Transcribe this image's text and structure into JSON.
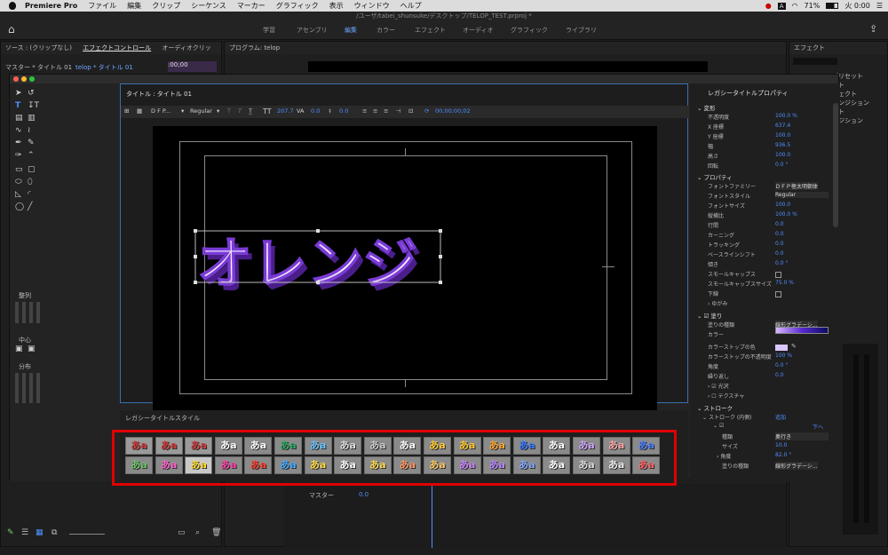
{
  "menubar": {
    "app": "Premiere Pro",
    "items": [
      "ファイル",
      "編集",
      "クリップ",
      "シーケンス",
      "マーカー",
      "グラフィック",
      "表示",
      "ウィンドウ",
      "ヘルプ"
    ],
    "battery": "71%",
    "clock": "火 0:00"
  },
  "path_title": "/ユーザ/tabei_shunsuke/デスクトップ/TELOP_TEST.prproj *",
  "workspaces": {
    "tabs": [
      "学習",
      "アセンブリ",
      "編集",
      "カラー",
      "エフェクト",
      "オーディオ",
      "グラフィック",
      "ライブラリ"
    ],
    "active": "編集"
  },
  "left_panel": {
    "tabs": [
      "ソース : (クリップなし)",
      "エフェクトコントロール",
      "オーディオクリッ"
    ],
    "master": "マスター * タイトル 01",
    "sequence": "telop * タイトル 01",
    "timecode": ":00;00"
  },
  "program": {
    "title": "プログラム: telop"
  },
  "effects": {
    "title": "エフェクト",
    "items": [
      "プリセット",
      "ット",
      "フェクト",
      "ランジション",
      "クト",
      "ンジション"
    ]
  },
  "title_panel": {
    "title": "タイトル : タイトル 01",
    "font": "D F P...",
    "style": "Regular",
    "size": "207.7",
    "kerning": "0.0",
    "leading": "0.0",
    "timecode": "00;00;00;02",
    "text": "オレンジ"
  },
  "tools": {
    "align_label": "整列",
    "center_label": "中心",
    "dist_label": "分布"
  },
  "props": {
    "title": "レガシータイトルプロパティ",
    "sections": {
      "transform": "変形",
      "properties": "プロパティ",
      "fill": "塗り",
      "stroke": "ストローク",
      "inner_stroke": "ストローク (内側)",
      "distort": "ゆがみ"
    },
    "transform": [
      {
        "label": "不透明度",
        "value": "100.0 %"
      },
      {
        "label": "X 座標",
        "value": "637.4"
      },
      {
        "label": "Y 座標",
        "value": "100.0"
      },
      {
        "label": "幅",
        "value": "936.5"
      },
      {
        "label": "高さ",
        "value": "100.0"
      },
      {
        "label": "回転",
        "value": "0.0 °"
      }
    ],
    "properties": [
      {
        "label": "フォントファミリー",
        "value": "ＤＦＰ極太明朝体"
      },
      {
        "label": "フォントスタイル",
        "value": "Regular"
      },
      {
        "label": "フォントサイズ",
        "value": "100.0"
      },
      {
        "label": "縦横比",
        "value": "100.0 %"
      },
      {
        "label": "行間",
        "value": "0.0"
      },
      {
        "label": "カーニング",
        "value": "0.0"
      },
      {
        "label": "トラッキング",
        "value": "0.0"
      },
      {
        "label": "ベースラインシフト",
        "value": "0.0"
      },
      {
        "label": "傾き",
        "value": "0.0 °"
      },
      {
        "label": "スモールキャップス",
        "value": ""
      },
      {
        "label": "スモールキャップスサイズ",
        "value": "75.0 %"
      },
      {
        "label": "下線",
        "value": ""
      }
    ],
    "fill": [
      {
        "label": "塗りの種類",
        "value": "線形グラデーシ..."
      },
      {
        "label": "カラー",
        "value": ""
      },
      {
        "label": "カラーストップの色",
        "value": ""
      },
      {
        "label": "カラーストップの不透明度",
        "value": "100 %"
      },
      {
        "label": "角度",
        "value": "0.0 °"
      },
      {
        "label": "繰り返し",
        "value": "0.0"
      },
      {
        "label": "光沢",
        "value": ""
      },
      {
        "label": "テクスチャ",
        "value": ""
      }
    ],
    "stroke": {
      "add": "追加",
      "down": "下へ",
      "rows": [
        {
          "label": "種類",
          "value": "奥行き"
        },
        {
          "label": "サイズ",
          "value": "10.0"
        },
        {
          "label": "角度",
          "value": "82.0 °"
        },
        {
          "label": "塗りの種類",
          "value": "線形グラデーシ..."
        }
      ]
    }
  },
  "styles": {
    "title": "レガシータイトルスタイル",
    "row1": [
      "あa",
      "あa",
      "あa",
      "あa",
      "あa",
      "あa",
      "あa",
      "あa",
      "あa",
      "あa",
      "あa",
      "あa",
      "あa",
      "あa",
      "あa",
      "あa",
      "あa",
      "あa"
    ],
    "row2": [
      "あa",
      "あa",
      "あa",
      "あa",
      "あa",
      "あa",
      "あa",
      "あa",
      "あa",
      "あa",
      "あa",
      "あa",
      "あa",
      "あa",
      "あa",
      "あa",
      "あa",
      "あa"
    ]
  },
  "timeline": {
    "master": "マスター",
    "value": "0.0"
  },
  "colors": {
    "accent": "#4f8fff",
    "highlight_red": "#e00000"
  }
}
